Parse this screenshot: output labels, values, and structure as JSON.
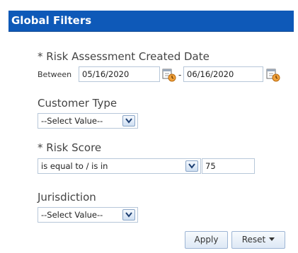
{
  "header": {
    "title": "Global Filters"
  },
  "risk_assessment": {
    "label": "* Risk Assessment Created Date",
    "between_label": "Between",
    "start_date": "05/16/2020",
    "separator": "-",
    "end_date": "06/16/2020"
  },
  "customer_type": {
    "label": "Customer Type",
    "selected": "--Select Value--"
  },
  "risk_score": {
    "label": "* Risk Score",
    "operator": "is equal to / is in",
    "value": "75"
  },
  "jurisdiction": {
    "label": "Jurisdiction",
    "selected": "--Select Value--"
  },
  "actions": {
    "apply": "Apply",
    "reset": "Reset"
  },
  "colors": {
    "header_bg": "#0e59b8",
    "header_text": "#ffffff",
    "input_border": "#b7c7d9"
  },
  "icons": {
    "date_picker": "calendar-clock-icon",
    "dropdown": "chevron-down-icon",
    "menu": "caret-down-icon"
  }
}
